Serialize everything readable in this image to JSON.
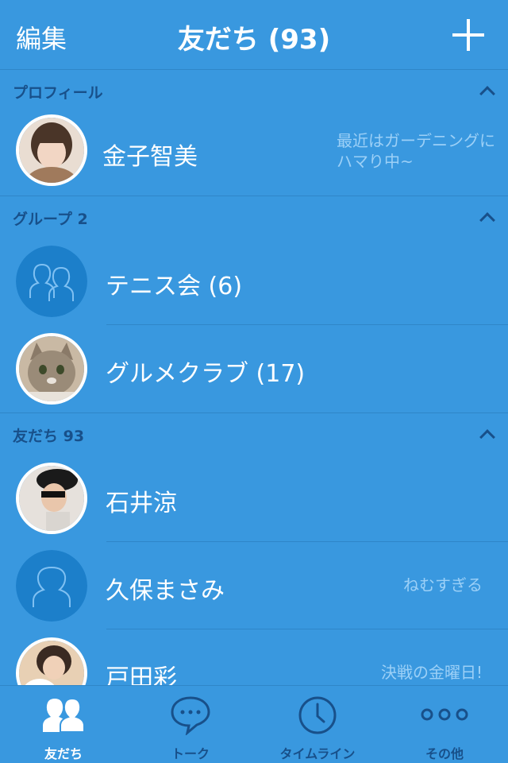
{
  "nav": {
    "edit_label": "編集",
    "title": "友だち (93)"
  },
  "profile_section": {
    "label": "プロフィール",
    "name": "金子智美",
    "status": "最近はガーデニングにハマり中~"
  },
  "group_section": {
    "label": "グループ 2",
    "items": [
      {
        "name": "テニス会 (6)"
      },
      {
        "name": "グルメクラブ (17)"
      }
    ]
  },
  "friends_section": {
    "label": "友だち 93",
    "items": [
      {
        "name": "石井涼",
        "status": ""
      },
      {
        "name": "久保まさみ",
        "status": "ねむすぎる"
      },
      {
        "name": "戸田彩",
        "status": "決戦の金曜日!"
      }
    ]
  },
  "tabs": [
    {
      "label": "友だち",
      "icon": "friends-icon",
      "active": true
    },
    {
      "label": "トーク",
      "icon": "chat-bubble-icon",
      "active": false
    },
    {
      "label": "タイムライン",
      "icon": "clock-icon",
      "active": false
    },
    {
      "label": "その他",
      "icon": "more-dots-icon",
      "active": false
    }
  ],
  "colors": {
    "background": "#3998df",
    "divider": "#2f86c8",
    "section_label": "#18508a",
    "status_text": "#9cd0f7"
  }
}
